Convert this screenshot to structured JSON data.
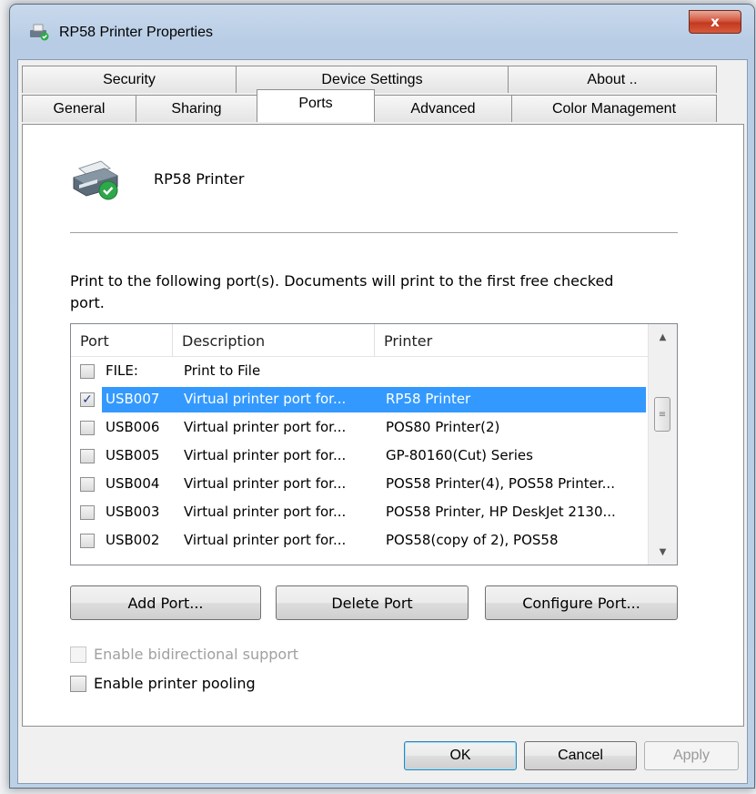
{
  "window": {
    "title": "RP58 Printer Properties",
    "close_label": "x"
  },
  "tabs": {
    "row1": [
      "Security",
      "Device Settings",
      "About .."
    ],
    "row2": [
      "General",
      "Sharing",
      "Ports",
      "Advanced",
      "Color Management"
    ],
    "selected": "Ports"
  },
  "ports_page": {
    "printer_name": "RP58 Printer",
    "instruction": "Print to the following port(s). Documents will print to the first free checked port.",
    "columns": [
      "Port",
      "Description",
      "Printer"
    ],
    "rows": [
      {
        "checked": false,
        "port": "FILE:",
        "description": "Print to File",
        "printer": ""
      },
      {
        "checked": true,
        "port": "USB007",
        "description": "Virtual printer port for...",
        "printer": "RP58 Printer"
      },
      {
        "checked": false,
        "port": "USB006",
        "description": "Virtual printer port for...",
        "printer": "POS80 Printer(2)"
      },
      {
        "checked": false,
        "port": "USB005",
        "description": "Virtual printer port for...",
        "printer": "GP-80160(Cut) Series"
      },
      {
        "checked": false,
        "port": "USB004",
        "description": "Virtual printer port for...",
        "printer": "POS58 Printer(4), POS58 Printer..."
      },
      {
        "checked": false,
        "port": "USB003",
        "description": "Virtual printer port for...",
        "printer": "POS58 Printer, HP DeskJet 2130..."
      },
      {
        "checked": false,
        "port": "USB002",
        "description": "Virtual printer port for...",
        "printer": "POS58(copy of 2), POS58"
      }
    ],
    "buttons": {
      "add_port": "Add Port...",
      "delete_port": "Delete Port",
      "configure_port": "Configure Port..."
    },
    "bidirectional": {
      "label": "Enable bidirectional support",
      "checked": false,
      "enabled": false
    },
    "pooling": {
      "label": "Enable printer pooling",
      "checked": false,
      "enabled": true
    }
  },
  "dialog_buttons": {
    "ok": "OK",
    "cancel": "Cancel",
    "apply": "Apply"
  },
  "colors": {
    "selection": "#3399ff",
    "title_bar": "#b8cde5",
    "close_button": "#c9452a"
  }
}
